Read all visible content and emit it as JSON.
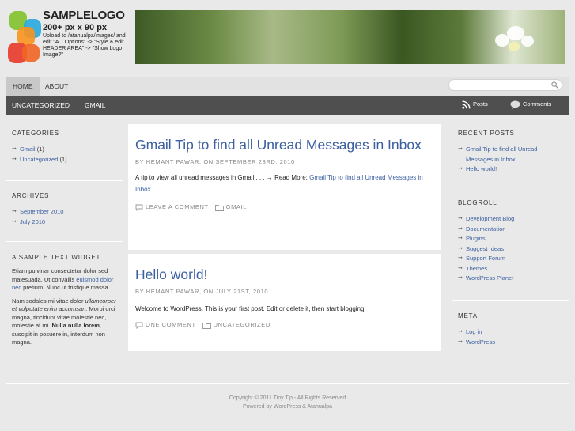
{
  "header": {
    "logo_title": "SAMPLELOGO",
    "logo_size": "200+ px x 90 px",
    "logo_desc": "Upload to /atahualpa/images/ and edit \"A.T.Options\" -> \"Style & edit HEADER AREA\" -> \"Show Logo Image?\""
  },
  "nav": {
    "pages": [
      "HOME",
      "ABOUT"
    ],
    "categories": [
      "UNCATEGORIZED",
      "GMAIL"
    ],
    "search_placeholder": "",
    "posts_feed": "Posts",
    "comments_feed": "Comments"
  },
  "left": {
    "categories_title": "CATEGORIES",
    "categories": [
      {
        "name": "Gmail",
        "count": "(1)"
      },
      {
        "name": "Uncategorized",
        "count": "(1)"
      }
    ],
    "archives_title": "ARCHIVES",
    "archives": [
      "September 2010",
      "July 2010"
    ],
    "text_widget_title": "A SAMPLE TEXT WIDGET",
    "text_p1_a": "Etiam pulvinar consectetur dolor sed malesuada. Ut convallis ",
    "text_p1_link": "euismod dolor nec",
    "text_p1_b": " pretium. Nunc ut tristique massa.",
    "text_p2_a": "Nam sodales mi vitae dolor ",
    "text_p2_em": "ullamcorper et vulputate enim accumsan.",
    "text_p2_b": " Morbi orci magna, tincidunt vitae molestie nec, molestie at mi. ",
    "text_p2_strong": "Nulla nulla lorem",
    "text_p2_c": ", suscipit in posuere in, interdum non magna."
  },
  "posts": [
    {
      "title": "Gmail Tip to find all Unread Messages in Inbox",
      "meta": "BY HEMANT PAWAR, ON SEPTEMBER 23RD, 2010",
      "excerpt": "A tip to view all unread messages in Gmail . . . → Read More: ",
      "read_more": "Gmail Tip to find all Unread Messages in Inbox",
      "comment_link": "LEAVE A COMMENT",
      "category": "GMAIL"
    },
    {
      "title": "Hello world!",
      "meta": "BY HEMANT PAWAR, ON JULY 21ST, 2010",
      "excerpt": "Welcome to WordPress. This is your first post. Edit or delete it, then start blogging!",
      "comment_link": "ONE COMMENT",
      "category": "UNCATEGORIZED"
    }
  ],
  "right": {
    "recent_title": "RECENT POSTS",
    "recent": [
      "Gmail Tip to find all Unread Messages in Inbox",
      "Hello world!"
    ],
    "blogroll_title": "BLOGROLL",
    "blogroll": [
      "Development Blog",
      "Documentation",
      "Plugins",
      "Suggest Ideas",
      "Support Forum",
      "Themes",
      "WordPress Planet"
    ],
    "meta_title": "META",
    "meta": [
      "Log in",
      "WordPress"
    ]
  },
  "footer": {
    "line1": "Copyright © 2011 Tiny Tip - All Rights Reserved",
    "line2": "Powered by WordPress & Atahualpa"
  },
  "colors": {
    "link": "#3b5fa0",
    "nav_dark": "#4f4f4f",
    "background": "#e9e9e9"
  }
}
